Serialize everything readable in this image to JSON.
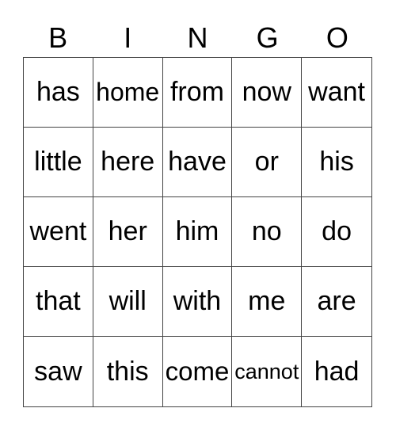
{
  "header": [
    "B",
    "I",
    "N",
    "G",
    "O"
  ],
  "cells": [
    [
      "has",
      "home",
      "from",
      "now",
      "want"
    ],
    [
      "little",
      "here",
      "have",
      "or",
      "his"
    ],
    [
      "went",
      "her",
      "him",
      "no",
      "do"
    ],
    [
      "that",
      "will",
      "with",
      "me",
      "are"
    ],
    [
      "saw",
      "this",
      "come",
      "cannot",
      "had"
    ]
  ]
}
